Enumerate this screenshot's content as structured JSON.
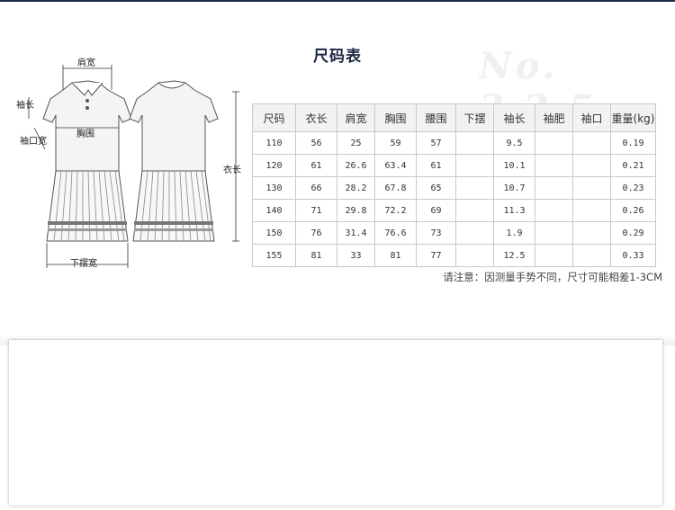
{
  "page": {
    "title": "尺码表",
    "note": "请注意：因测量手势不同，尺寸可能相差1-3CM"
  },
  "diagram": {
    "shoulder_label": "肩宽",
    "sleeve_length_label": "袖长",
    "cuff_label": "袖口宽",
    "chest_label": "胸围",
    "length_label": "衣长",
    "hem_label": "下摆宽"
  },
  "table": {
    "headers": [
      "尺码",
      "衣长",
      "肩宽",
      "胸围",
      "腰围",
      "下摆",
      "袖长",
      "袖肥",
      "袖口",
      "重量(kg)"
    ],
    "rows": [
      [
        "110",
        "56",
        "25",
        "59",
        "57",
        "",
        "9.5",
        "",
        "",
        "0.19"
      ],
      [
        "120",
        "61",
        "26.6",
        "63.4",
        "61",
        "",
        "10.1",
        "",
        "",
        "0.21"
      ],
      [
        "130",
        "66",
        "28.2",
        "67.8",
        "65",
        "",
        "10.7",
        "",
        "",
        "0.23"
      ],
      [
        "140",
        "71",
        "29.8",
        "72.2",
        "69",
        "",
        "11.3",
        "",
        "",
        "0.26"
      ],
      [
        "150",
        "76",
        "31.4",
        "76.6",
        "73",
        "",
        "1.9",
        "",
        "",
        "0.29"
      ],
      [
        "155",
        "81",
        "33",
        "81",
        "77",
        "",
        "12.5",
        "",
        "",
        "0.33"
      ]
    ]
  },
  "colors": {
    "title": "#1c2745",
    "header_bg": "#f2f2f2",
    "border": "#c8c8c8"
  }
}
